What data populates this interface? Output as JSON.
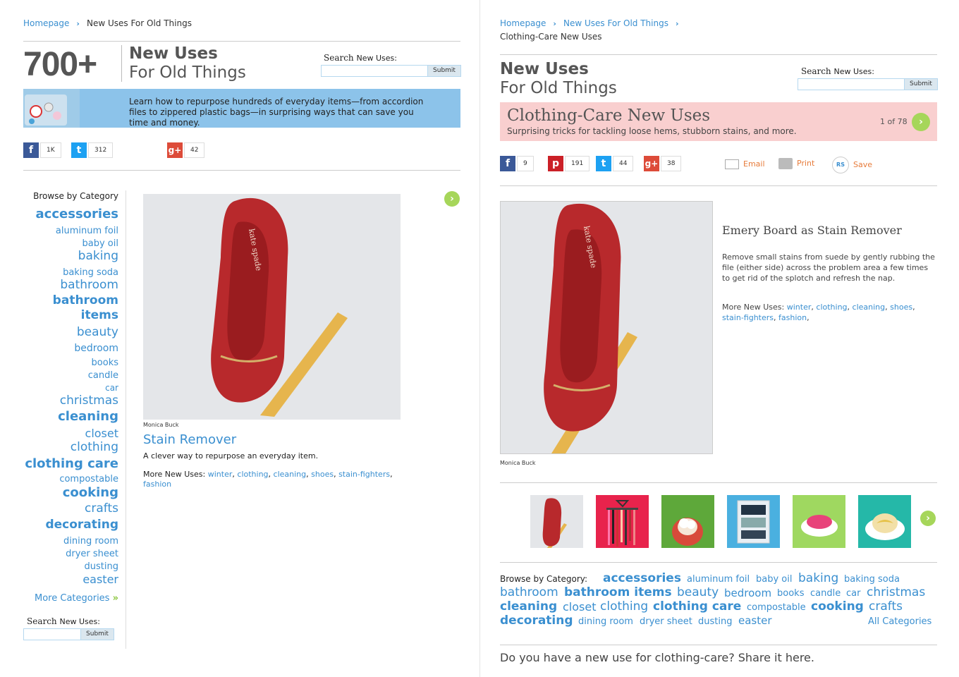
{
  "left": {
    "breadcrumb": {
      "home": "Homepage",
      "current": "New Uses For Old Things"
    },
    "header": {
      "big_number": "700+",
      "title_line1": "New Uses",
      "title_line2": "For Old Things"
    },
    "search": {
      "label_a": "Search",
      "label_b": "New Uses:",
      "button": "Submit"
    },
    "banner": {
      "text": "Learn how to repurpose hundreds of everyday items—from accordion files to zippered plastic bags—in surprising ways that can save you time and money."
    },
    "social": {
      "facebook": "1K",
      "twitter": "312",
      "googleplus": "42"
    },
    "browse_title": "Browse by Category",
    "categories": [
      {
        "label": "accessories"
      },
      {
        "label": "aluminum foil"
      },
      {
        "label": "baby oil"
      },
      {
        "label": "baking"
      },
      {
        "label": "baking soda"
      },
      {
        "label": "bathroom"
      },
      {
        "label": "bathroom"
      },
      {
        "label": "items"
      },
      {
        "label": "beauty"
      },
      {
        "label": "bedroom"
      },
      {
        "label": "books"
      },
      {
        "label": "candle"
      },
      {
        "label": "car"
      },
      {
        "label": "christmas"
      },
      {
        "label": "cleaning"
      },
      {
        "label": "closet"
      },
      {
        "label": "clothing"
      },
      {
        "label": "clothing care"
      },
      {
        "label": "compostable"
      },
      {
        "label": "cooking"
      },
      {
        "label": "crafts"
      },
      {
        "label": "decorating"
      },
      {
        "label": "dining room"
      },
      {
        "label": "dryer sheet"
      },
      {
        "label": "dusting"
      },
      {
        "label": "easter"
      }
    ],
    "more_categories": "More Categories",
    "bottom_search": {
      "label_a": "Search",
      "label_b": "New Uses:",
      "button": "Submit"
    },
    "article": {
      "photo_credit": "Monica Buck",
      "title": "Stain Remover",
      "summary": "A clever way to repurpose an everyday item.",
      "more_label": "More New Uses:",
      "tags": [
        "winter",
        "clothing",
        "cleaning",
        "shoes",
        "stain-fighters",
        "fashion"
      ]
    }
  },
  "right": {
    "breadcrumb": {
      "home": "Homepage",
      "section": "New Uses For Old Things",
      "current": "Clothing-Care New Uses"
    },
    "header": {
      "title_line1": "New Uses",
      "title_line2": "For Old Things"
    },
    "search": {
      "label_a": "Search",
      "label_b": "New Uses:",
      "button": "Submit"
    },
    "banner": {
      "title": "Clothing-Care New Uses",
      "subtitle": "Surprising tricks for tackling loose hems, stubborn stains, and more.",
      "counter": "1 of 78"
    },
    "social": {
      "facebook": "9",
      "pinterest": "191",
      "twitter": "44",
      "googleplus": "38"
    },
    "actions": {
      "email": "Email",
      "print": "Print",
      "save": "Save",
      "save_badge": "RS"
    },
    "article": {
      "photo_credit": "Monica Buck",
      "title": "Emery Board as Stain Remover",
      "body": "Remove small stains from suede by gently rubbing the file (either side) across the problem area a few times to get rid of the splotch and refresh the nap.",
      "more_label": "More New Uses:",
      "tags": [
        "winter",
        "clothing",
        "cleaning",
        "shoes",
        "stain-fighters",
        "fashion"
      ]
    },
    "browse_label": "Browse by Category:",
    "categories": [
      "accessories",
      "aluminum foil",
      "baby oil",
      "baking",
      "baking soda",
      "bathroom",
      "bathroom items",
      "beauty",
      "bedroom",
      "books",
      "candle",
      "car",
      "christmas",
      "cleaning",
      "closet",
      "clothing",
      "clothing care",
      "compostable",
      "cooking",
      "crafts",
      "decorating",
      "dining room",
      "dryer sheet",
      "dusting",
      "easter"
    ],
    "all_categories": "All Categories",
    "share_prompt": "Do you have a new use for clothing-care? Share it here."
  },
  "colors": {
    "link": "#3a8fd0",
    "banner_blue": "#8cc3ea",
    "banner_pink": "#f9cfcf",
    "accent_green": "#a6d65a",
    "action_orange": "#e77b3a"
  }
}
